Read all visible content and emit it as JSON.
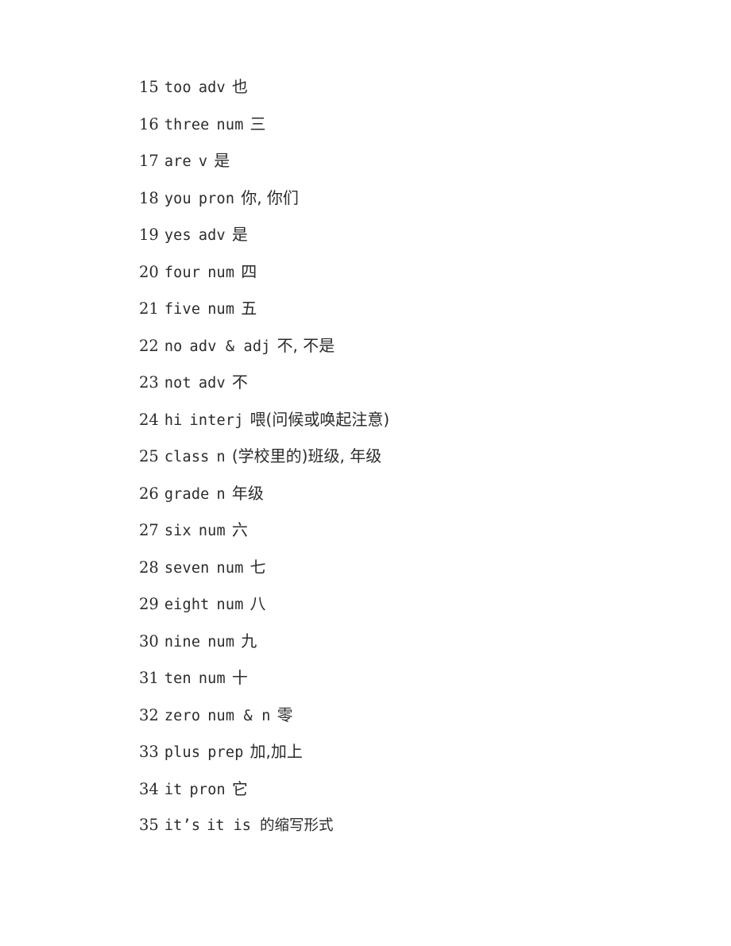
{
  "document": {
    "kind": "vocabulary-word-list",
    "page_background": "#ffffff",
    "text_color": "#2b2b2b"
  },
  "entries": [
    {
      "num": "15",
      "term": "too",
      "pos": "adv",
      "def": "也",
      "def_style": "cjk"
    },
    {
      "num": "16",
      "term": "three",
      "pos": "num",
      "def": "三",
      "def_style": "cjk"
    },
    {
      "num": "17",
      "term": "are",
      "pos": "v",
      "def": "是",
      "def_style": "cjk"
    },
    {
      "num": "18",
      "term": "you",
      "pos": "pron",
      "def": "你, 你们",
      "def_style": "cjk"
    },
    {
      "num": "19",
      "term": "yes",
      "pos": "adv",
      "def": "是",
      "def_style": "cjk"
    },
    {
      "num": "20",
      "term": "four",
      "pos": "num",
      "def": "四",
      "def_style": "cjk"
    },
    {
      "num": "21",
      "term": "five",
      "pos": "num",
      "def": "五",
      "def_style": "cjk"
    },
    {
      "num": "22",
      "term": "no",
      "pos": "adv & adj",
      "def": "不, 不是",
      "def_style": "cjk"
    },
    {
      "num": "23",
      "term": "not",
      "pos": "adv",
      "def": "不",
      "def_style": "cjk"
    },
    {
      "num": "24",
      "term": "hi",
      "pos": "interj",
      "def": "喂(问候或唤起注意)",
      "def_style": "cjk"
    },
    {
      "num": "25",
      "term": "class",
      "pos": "n",
      "def": "(学校里的)班级, 年级",
      "def_style": "cjk"
    },
    {
      "num": "26",
      "term": "grade",
      "pos": "n",
      "def": "年级",
      "def_style": "cjk"
    },
    {
      "num": "27",
      "term": "six",
      "pos": "num",
      "def": "六",
      "def_style": "cjk"
    },
    {
      "num": "28",
      "term": "seven",
      "pos": "num",
      "def": "七",
      "def_style": "cjk"
    },
    {
      "num": "29",
      "term": "eight",
      "pos": "num",
      "def": "八",
      "def_style": "cjk"
    },
    {
      "num": "30",
      "term": "nine",
      "pos": "num",
      "def": "九",
      "def_style": "cjk"
    },
    {
      "num": "31",
      "term": "ten",
      "pos": "num",
      "def": "十",
      "def_style": "cjk"
    },
    {
      "num": "32",
      "term": "zero",
      "pos": "num & n",
      "def": "零",
      "def_style": "cjk"
    },
    {
      "num": "33",
      "term": "plus",
      "pos": "prep",
      "def": "加,加上",
      "def_style": "cjk"
    },
    {
      "num": "34",
      "term": "it",
      "pos": "pron",
      "def": "它",
      "def_style": "cjk"
    },
    {
      "num": "35",
      "term": "it’s",
      "pos": "",
      "def": "it is 的缩写形式",
      "def_style": "latin-lead"
    }
  ]
}
